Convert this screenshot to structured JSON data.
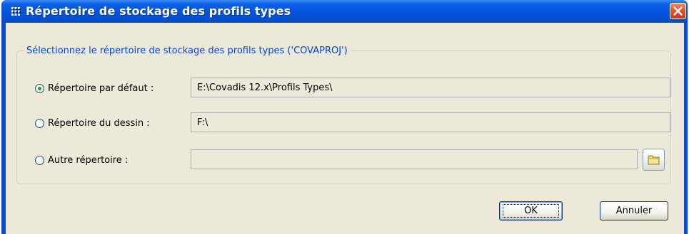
{
  "window": {
    "title": "Répertoire de stockage des profils types",
    "icon": "grid-app-icon",
    "close_icon": "close-icon",
    "accent": "#0a51d4",
    "close_color": "#e0542a"
  },
  "group": {
    "legend": "Sélectionnez le répertoire de stockage des profils types ('COVAPROJ')",
    "legend_color": "#0046d5"
  },
  "options": [
    {
      "label": "Répertoire par défaut :",
      "checked": true,
      "path": "E:\\Covadis 12.x\\Profils Types\\"
    },
    {
      "label": "Répertoire du dessin :",
      "checked": false,
      "path": "F:\\"
    },
    {
      "label": "Autre répertoire :",
      "checked": false,
      "path": ""
    }
  ],
  "browse": {
    "icon": "folder-icon"
  },
  "buttons": {
    "ok": "OK",
    "cancel": "Annuler"
  }
}
